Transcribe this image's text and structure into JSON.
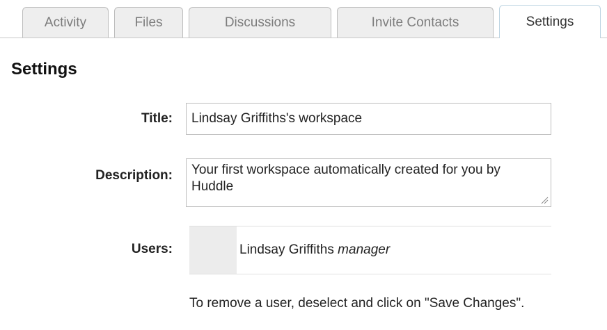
{
  "tabs": [
    {
      "label": "Activity",
      "active": false
    },
    {
      "label": "Files",
      "active": false
    },
    {
      "label": "Discussions",
      "active": false
    },
    {
      "label": "Invite Contacts",
      "active": false
    },
    {
      "label": "Settings",
      "active": true
    }
  ],
  "settings": {
    "heading": "Settings",
    "title_label": "Title:",
    "title_value": "Lindsay Griffiths's workspace",
    "description_label": "Description:",
    "description_value": "Your first workspace automatically created for you by Huddle",
    "users_label": "Users:",
    "users": [
      {
        "name": "Lindsay Griffiths",
        "role": "manager"
      }
    ],
    "remove_help": "To remove a user, deselect and click on \"Save Changes\"."
  },
  "colors": {
    "tab_inactive_bg": "#eeeeee",
    "tab_active_border": "#bcd4e2",
    "input_border": "#bdbdbd",
    "user_select_bg": "#ececec"
  }
}
